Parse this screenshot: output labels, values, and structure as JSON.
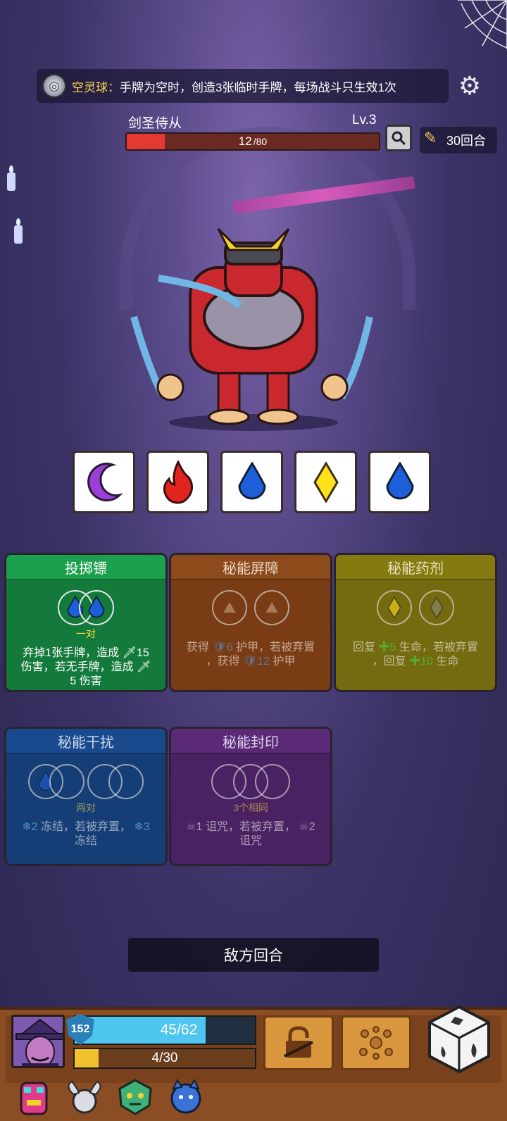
{
  "relic_banner": {
    "name": "空灵球：",
    "description": "手牌为空时，创造3张临时手牌，每场战斗只生效1次"
  },
  "enemy": {
    "name": "剑圣侍从",
    "level": "Lv.3",
    "hp_current": "12",
    "hp_max": "/80",
    "hp_fraction": 0.15
  },
  "turns": "30回合",
  "intents": [
    {
      "icon": "purple-moon-icon",
      "color": "#9b3fd6"
    },
    {
      "icon": "red-flame-icon",
      "color": "#e2241f"
    },
    {
      "icon": "blue-drop-icon",
      "color": "#1d5fd8"
    },
    {
      "icon": "yellow-diamond-icon",
      "color": "#ffe21a"
    },
    {
      "icon": "blue-drop-icon",
      "color": "#1d5fd8"
    }
  ],
  "cards": {
    "throw_dart": {
      "title": "投掷镖",
      "requirement": "一对",
      "effect_line1": "弃掉1张手牌，造成",
      "effect_val1": "15",
      "effect_line2a": "伤害，若无手牌，造成",
      "effect_line2b": "5 伤害"
    },
    "arcane_barrier": {
      "title": "秘能屏障",
      "effect_a": "获得",
      "effect_val1": "6",
      "effect_b": "护甲，若被弃置",
      "effect_c": "，获得",
      "effect_val2": "12",
      "effect_d": "护甲"
    },
    "arcane_potion": {
      "title": "秘能药剂",
      "effect_a": "回复",
      "effect_val1": "5",
      "effect_b": "生命，若被弃置",
      "effect_c": "，回复",
      "effect_val2": "10",
      "effect_d": "生命"
    },
    "arcane_disrupt": {
      "title": "秘能干扰",
      "requirement": "两对",
      "effect_val1": "2",
      "effect_a": "冻结，若被弃置，",
      "effect_val2": "3",
      "effect_b": "冻结"
    },
    "arcane_seal": {
      "title": "秘能封印",
      "requirement": "3个相同",
      "effect_val1": "1",
      "effect_a": "诅咒，若被弃置，",
      "effect_val2": "2",
      "effect_b": "诅咒"
    }
  },
  "enemy_turn_label": "敌方回合",
  "player": {
    "armor": "152",
    "hp": "45/62",
    "hp_fraction": 0.726,
    "energy": "4/30",
    "energy_fraction": 0.133
  },
  "colors": {
    "enemy_hp": "#e23a33",
    "player_hp": "#4fc6f0",
    "energy": "#f2c12e",
    "highlight_text": "#ffd84a"
  }
}
